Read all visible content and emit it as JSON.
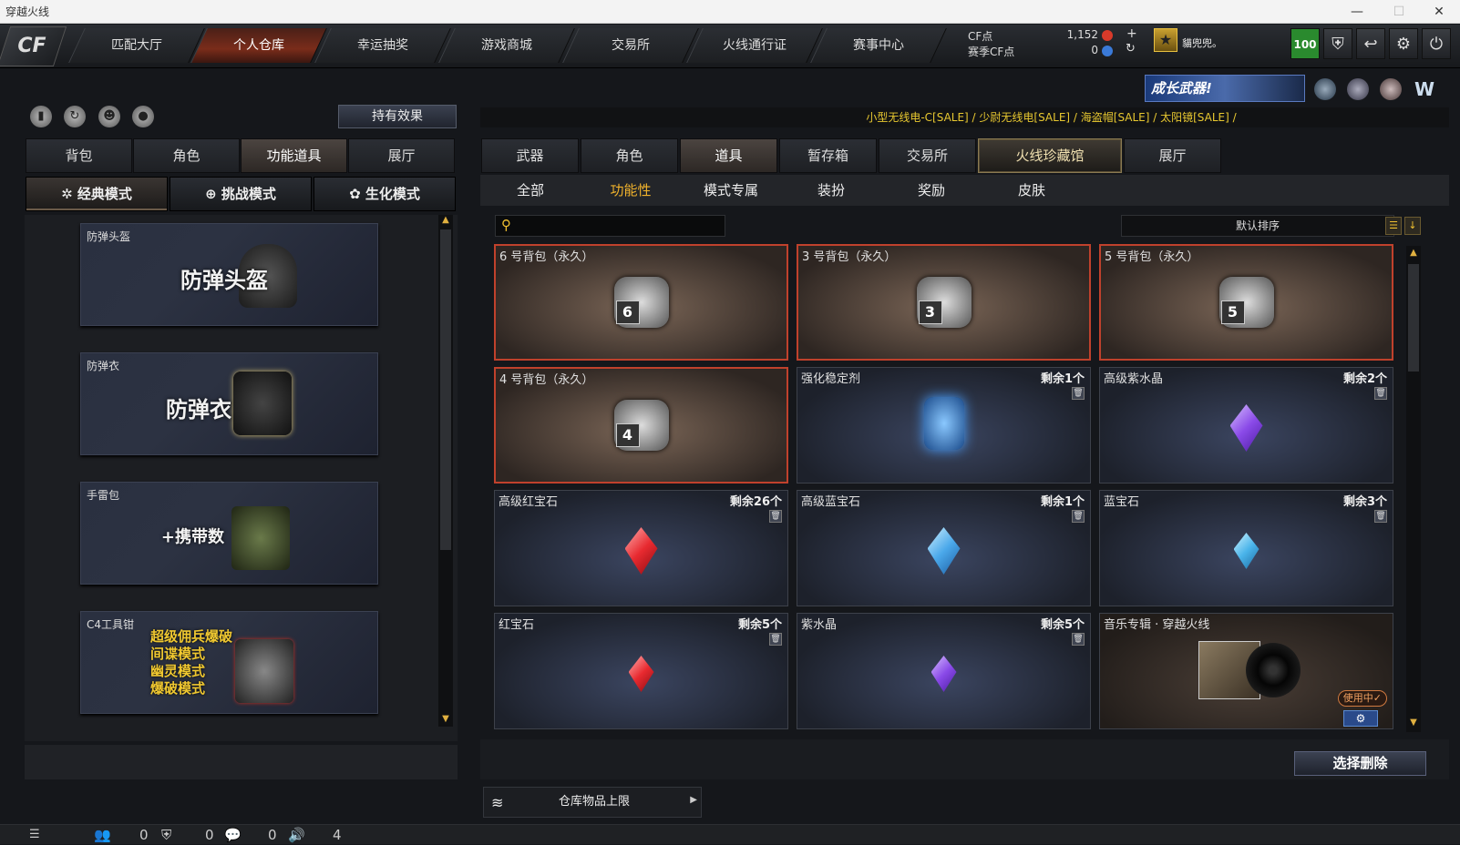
{
  "window": {
    "title": "穿越火线",
    "controls": [
      "—",
      "☐",
      "✕"
    ]
  },
  "nav": {
    "logo": "CF",
    "tabs": [
      "匹配大厅",
      "个人仓库",
      "幸运抽奖",
      "游戏商城",
      "交易所",
      "火线通行证",
      "赛事中心"
    ],
    "active_index": 1
  },
  "currency": {
    "cf_label": "CF点",
    "cf_value": "1,152",
    "season_label": "赛季CF点",
    "season_value": "0"
  },
  "user": {
    "name": "貓兜兜。",
    "level": "100"
  },
  "promo": {
    "banner_text": "成长武器!"
  },
  "left": {
    "hold_effect": "持有效果",
    "tabs": [
      "背包",
      "角色",
      "功能道具",
      "展厅"
    ],
    "active_tab": 2,
    "modes": [
      "经典模式",
      "挑战模式",
      "生化模式"
    ],
    "active_mode": 0,
    "cards": [
      {
        "caption": "防弹头盔",
        "art": "防弹头盔"
      },
      {
        "caption": "防弹衣",
        "art": "防弹衣"
      },
      {
        "caption": "手雷包",
        "art": "+携带数"
      },
      {
        "caption": "C4工具钳",
        "art_lines": [
          "超级佣兵爆破",
          "间谍模式",
          "幽灵模式",
          "爆破模式"
        ]
      }
    ]
  },
  "right": {
    "announce": "小型无线电-C[SALE] / 少尉无线电[SALE] / 海盗帽[SALE] / 太阳镜[SALE] /",
    "tabs": [
      "武器",
      "角色",
      "道具",
      "暂存箱",
      "交易所",
      "火线珍藏馆",
      "展厅"
    ],
    "active_tab": 2,
    "special_tab": 5,
    "subtabs": [
      "全部",
      "功能性",
      "模式专属",
      "装扮",
      "奖励",
      "皮肤"
    ],
    "active_subtab": 1,
    "search_placeholder": "",
    "sort_label": "默认排序",
    "items": [
      {
        "name": "6 号背包（永久）",
        "count": "",
        "type": "bag",
        "bag_no": "6"
      },
      {
        "name": "3 号背包（永久）",
        "count": "",
        "type": "bag",
        "bag_no": "3"
      },
      {
        "name": "5 号背包（永久）",
        "count": "",
        "type": "bag",
        "bag_no": "5"
      },
      {
        "name": "4 号背包（永久）",
        "count": "",
        "type": "bag",
        "bag_no": "4"
      },
      {
        "name": "强化稳定剂",
        "count": "剩余1个",
        "type": "stabilizer"
      },
      {
        "name": "高级紫水晶",
        "count": "剩余2个",
        "type": "gem",
        "color": "#9b6cf0"
      },
      {
        "name": "高级红宝石",
        "count": "剩余26个",
        "type": "gem",
        "color": "#e8303a"
      },
      {
        "name": "高级蓝宝石",
        "count": "剩余1个",
        "type": "gem",
        "color": "#4aa8ea"
      },
      {
        "name": "蓝宝石",
        "count": "剩余3个",
        "type": "gem-small",
        "color": "#4ab4ea"
      },
      {
        "name": "红宝石",
        "count": "剩余5个",
        "type": "gem-small",
        "color": "#e8303a"
      },
      {
        "name": "紫水晶",
        "count": "剩余5个",
        "type": "gem-small",
        "color": "#9060e8"
      },
      {
        "name": "音乐专辑 · 穿越火线",
        "count": "",
        "type": "album",
        "badge": "使用中✓"
      }
    ],
    "select_delete": "选择删除",
    "capacity_label": "仓库物品上限"
  },
  "status": {
    "v1": "0",
    "v2": "0",
    "v3": "0",
    "v4": "4"
  }
}
